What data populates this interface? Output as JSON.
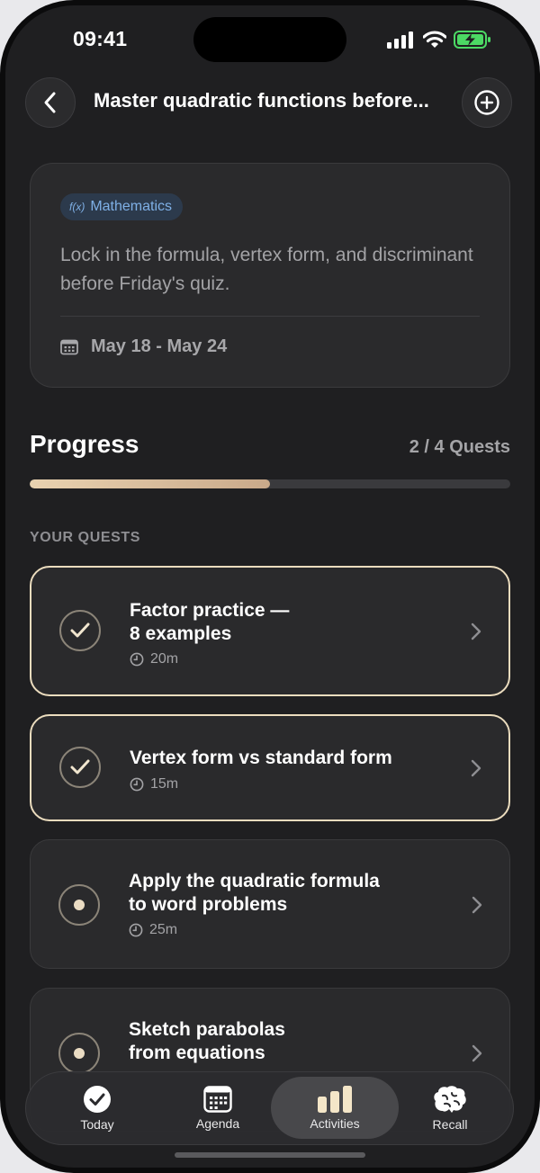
{
  "status_bar": {
    "time": "09:41"
  },
  "header": {
    "title": "Master quadratic functions before..."
  },
  "goal": {
    "subject_tag": "Mathematics",
    "subject_icon_text": "f(x)",
    "description": "Lock in the formula, vertex form, and discriminant before Friday's quiz.",
    "date_range": "May 18 - May 24"
  },
  "progress": {
    "label": "Progress",
    "count_text": "2 / 4 Quests",
    "completed": 2,
    "total": 4
  },
  "quests_section_label": "YOUR QUESTS",
  "quests": [
    {
      "title_line1": "Factor practice —",
      "title_line2": "8 examples",
      "duration": "20m",
      "status": "done"
    },
    {
      "title_line1": "Vertex form vs standard form",
      "title_line2": "",
      "duration": "15m",
      "status": "done"
    },
    {
      "title_line1": "Apply the quadratic formula",
      "title_line2": "to word problems",
      "duration": "25m",
      "status": "pending"
    },
    {
      "title_line1": "Sketch parabolas",
      "title_line2": "from equations",
      "duration": "",
      "status": "pending"
    }
  ],
  "tabs": [
    {
      "label": "Today",
      "icon": "check-circle-icon"
    },
    {
      "label": "Agenda",
      "icon": "calendar-icon"
    },
    {
      "label": "Activities",
      "icon": "bar-chart-icon",
      "active": true
    },
    {
      "label": "Recall",
      "icon": "brain-icon"
    }
  ],
  "colors": {
    "accent": "#ebdcbe",
    "background": "#1f1f21",
    "card": "#2a2a2c",
    "tag_text": "#7fb0e6",
    "battery": "#4cd964"
  }
}
